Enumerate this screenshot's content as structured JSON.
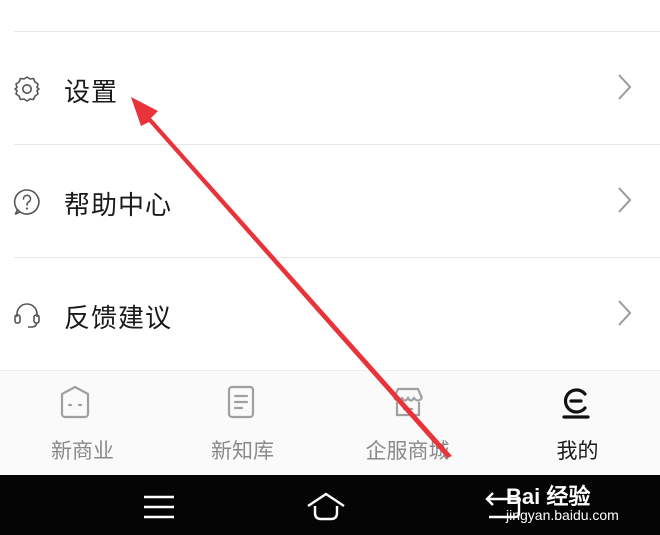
{
  "menu": {
    "items": [
      {
        "label": "设置",
        "icon": "settings-gear-icon"
      },
      {
        "label": "帮助中心",
        "icon": "help-question-icon"
      },
      {
        "label": "反馈建议",
        "icon": "headset-icon"
      }
    ]
  },
  "tabbar": {
    "tabs": [
      {
        "label": "新商业",
        "icon": "business-icon",
        "active": false
      },
      {
        "label": "新知库",
        "icon": "document-icon",
        "active": false
      },
      {
        "label": "企服商城",
        "icon": "store-icon",
        "active": false
      },
      {
        "label": "我的",
        "icon": "profile-icon",
        "active": true
      }
    ]
  },
  "system_nav": {
    "buttons": [
      "menu-icon",
      "home-icon",
      "back-icon"
    ]
  },
  "annotation": {
    "color": "#e8333a"
  },
  "watermark": {
    "logo": "Bai 经验",
    "url": "jingyan.baidu.com"
  }
}
